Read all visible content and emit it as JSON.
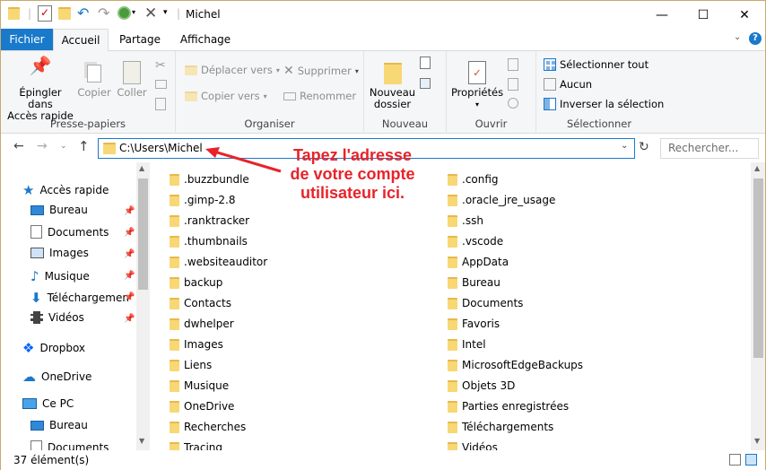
{
  "window": {
    "title": "Michel"
  },
  "tabs": {
    "file": "Fichier",
    "home": "Accueil",
    "share": "Partage",
    "view": "Affichage"
  },
  "ribbon": {
    "pin_l1": "Épingler dans",
    "pin_l2": "Accès rapide",
    "copy": "Copier",
    "paste": "Coller",
    "clipboard": "Presse-papiers",
    "move_to": "Déplacer vers",
    "copy_to": "Copier vers",
    "delete": "Supprimer",
    "rename": "Renommer",
    "organize": "Organiser",
    "new_folder_l1": "Nouveau",
    "new_folder_l2": "dossier",
    "new": "Nouveau",
    "properties": "Propriétés",
    "open": "Ouvrir",
    "select_all": "Sélectionner tout",
    "select_none": "Aucun",
    "invert": "Inverser la sélection",
    "select": "Sélectionner"
  },
  "address": {
    "path": "C:\\Users\\Michel",
    "search_placeholder": "Rechercher..."
  },
  "annotation": {
    "l1": "Tapez l'adresse",
    "l2": "de votre compte",
    "l3": "utilisateur ici."
  },
  "nav": {
    "quick": "Accès rapide",
    "desktop": "Bureau",
    "documents": "Documents",
    "images": "Images",
    "music": "Musique",
    "downloads": "Téléchargemen",
    "videos": "Vidéos",
    "dropbox": "Dropbox",
    "onedrive": "OneDrive",
    "pc": "Ce PC",
    "pc_desktop": "Bureau",
    "pc_documents": "Documents"
  },
  "files_col1": [
    ".buzzbundle",
    ".gimp-2.8",
    ".ranktracker",
    ".thumbnails",
    ".websiteauditor",
    "backup",
    "Contacts",
    "dwhelper",
    "Images",
    "Liens",
    "Musique",
    "OneDrive",
    "Recherches",
    "Tracing"
  ],
  "files_col2": [
    ".config",
    ".oracle_jre_usage",
    ".ssh",
    ".vscode",
    "AppData",
    "Bureau",
    "Documents",
    "Favoris",
    "Intel",
    "MicrosoftEdgeBackups",
    "Objets 3D",
    "Parties enregistrées",
    "Téléchargements",
    "Vidéos"
  ],
  "status": {
    "count": "37 élément(s)"
  }
}
